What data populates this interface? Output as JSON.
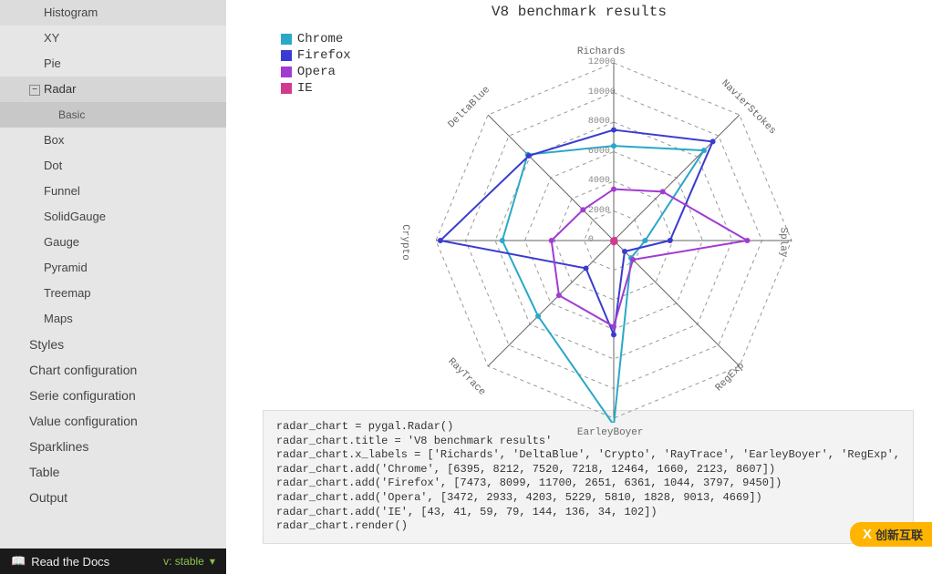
{
  "sidebar": {
    "items": [
      {
        "label": "Histogram",
        "cls": "nav-item"
      },
      {
        "label": "XY",
        "cls": "nav-item"
      },
      {
        "label": "Pie",
        "cls": "nav-item"
      },
      {
        "label": "Radar",
        "cls": "nav-item selected",
        "expand": "⊟"
      },
      {
        "label": "Basic",
        "cls": "nav-item child"
      },
      {
        "label": "Box",
        "cls": "nav-item"
      },
      {
        "label": "Dot",
        "cls": "nav-item"
      },
      {
        "label": "Funnel",
        "cls": "nav-item"
      },
      {
        "label": "SolidGauge",
        "cls": "nav-item"
      },
      {
        "label": "Gauge",
        "cls": "nav-item"
      },
      {
        "label": "Pyramid",
        "cls": "nav-item"
      },
      {
        "label": "Treemap",
        "cls": "nav-item"
      },
      {
        "label": "Maps",
        "cls": "nav-item"
      },
      {
        "label": "Styles",
        "cls": "nav-item top"
      },
      {
        "label": "Chart configuration",
        "cls": "nav-item top"
      },
      {
        "label": "Serie configuration",
        "cls": "nav-item top"
      },
      {
        "label": "Value configuration",
        "cls": "nav-item top"
      },
      {
        "label": "Sparklines",
        "cls": "nav-item top"
      },
      {
        "label": "Table",
        "cls": "nav-item top"
      },
      {
        "label": "Output",
        "cls": "nav-item top"
      }
    ],
    "rtd_label": "Read the Docs",
    "rtd_version": "v: stable"
  },
  "chart_data": {
    "type": "radar",
    "title": "V8 benchmark results",
    "categories": [
      "Richards",
      "NavierStokes",
      "Splay",
      "RegExp",
      "EarleyBoyer",
      "RayTrace",
      "Crypto",
      "DeltaBlue"
    ],
    "ticks": [
      0,
      2000,
      4000,
      6000,
      8000,
      10000,
      12000
    ],
    "max": 12000,
    "series": [
      {
        "name": "Chrome",
        "color": "#2aa8c9",
        "values": [
          6395,
          8607,
          2123,
          1660,
          12464,
          7218,
          7520,
          8212
        ]
      },
      {
        "name": "Firefox",
        "color": "#3a3bd1",
        "values": [
          7473,
          9450,
          3797,
          1044,
          6361,
          2651,
          11700,
          8099
        ]
      },
      {
        "name": "Opera",
        "color": "#a23bd1",
        "values": [
          3472,
          4669,
          9013,
          1828,
          5810,
          5229,
          4203,
          2933
        ]
      },
      {
        "name": "IE",
        "color": "#d13b8f",
        "values": [
          43,
          102,
          34,
          136,
          144,
          79,
          59,
          41
        ]
      }
    ]
  },
  "code": "radar_chart = pygal.Radar()\nradar_chart.title = 'V8 benchmark results'\nradar_chart.x_labels = ['Richards', 'DeltaBlue', 'Crypto', 'RayTrace', 'EarleyBoyer', 'RegExp',\nradar_chart.add('Chrome', [6395, 8212, 7520, 7218, 12464, 1660, 2123, 8607])\nradar_chart.add('Firefox', [7473, 8099, 11700, 2651, 6361, 1044, 3797, 9450])\nradar_chart.add('Opera', [3472, 2933, 4203, 5229, 5810, 1828, 9013, 4669])\nradar_chart.add('IE', [43, 41, 59, 79, 144, 136, 34, 102])\nradar_chart.render()",
  "watermark": "创新互联"
}
